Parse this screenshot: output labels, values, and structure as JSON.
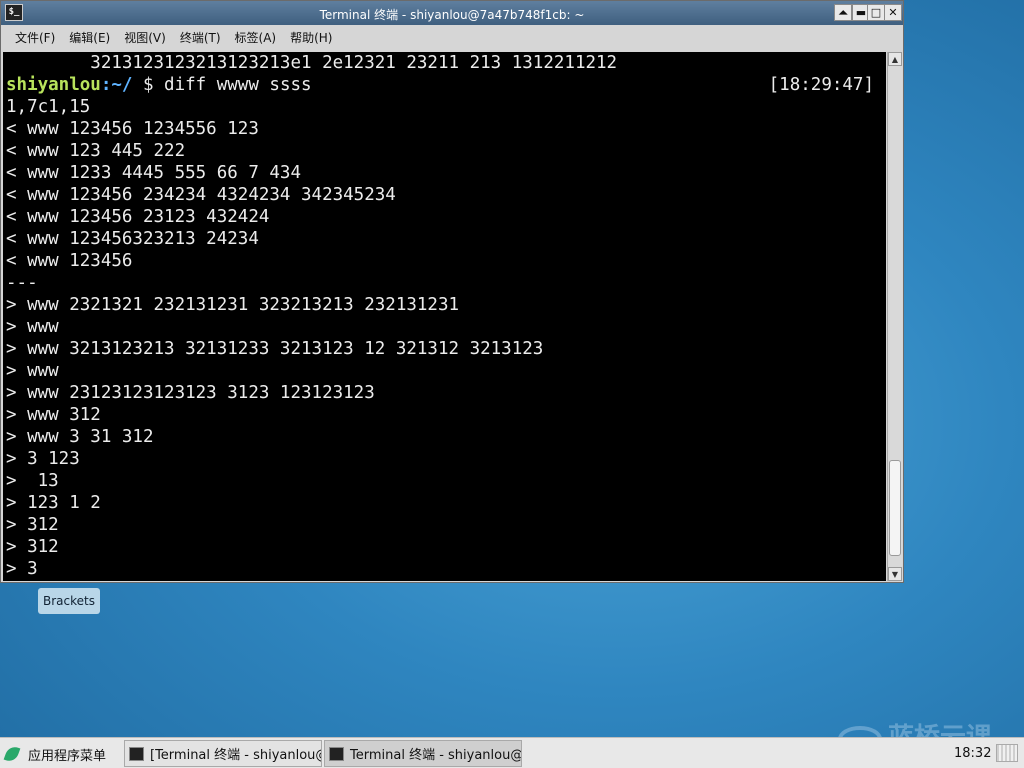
{
  "window": {
    "title": "Terminal 终端 - shiyanlou@7a47b748f1cb: ~",
    "app_icon": "$_",
    "controls": {
      "shade": "⏶",
      "minimize": "▬",
      "maximize": "□",
      "close": "✕"
    }
  },
  "menu": [
    "文件(F)",
    "编辑(E)",
    "视图(V)",
    "终端(T)",
    "标签(A)",
    "帮助(H)"
  ],
  "terminal": {
    "first_line": "        3213123123213123213e1 2e12321 23211 213 1312211212",
    "prompt": {
      "user": "shiyanlou",
      "path": ":~/",
      "command": " $ diff wwww ssss",
      "time": "[18:29:47]"
    },
    "output": [
      "1,7c1,15",
      "< www 123456 1234556 123",
      "< www 123 445 222",
      "< www 1233 4445 555 66 7 434",
      "< www 123456 234234 4324234 342345234",
      "< www 123456 23123 432424",
      "< www 123456323213 24234",
      "< www 123456",
      "---",
      "> www 2321321 232131231 323213213 232131231",
      "> www",
      "> www 3213123213 32131233 3213123 12 321312 3213123",
      "> www",
      "> www 23123123123123 3123 123123123",
      "> www 312",
      "> www 3 31 312",
      "> 3 123",
      ">  13",
      "> 123 1 2",
      "> 312",
      "> 312",
      "> 3"
    ]
  },
  "desktop": {
    "item_label": "Brackets",
    "watermark": "蓝桥云课"
  },
  "taskbar": {
    "start_label": "应用程序菜单",
    "tasks": [
      "[Terminal 终端 - shiyanlou@…",
      "Terminal 终端 - shiyanlou@…"
    ],
    "clock": "18:32"
  }
}
